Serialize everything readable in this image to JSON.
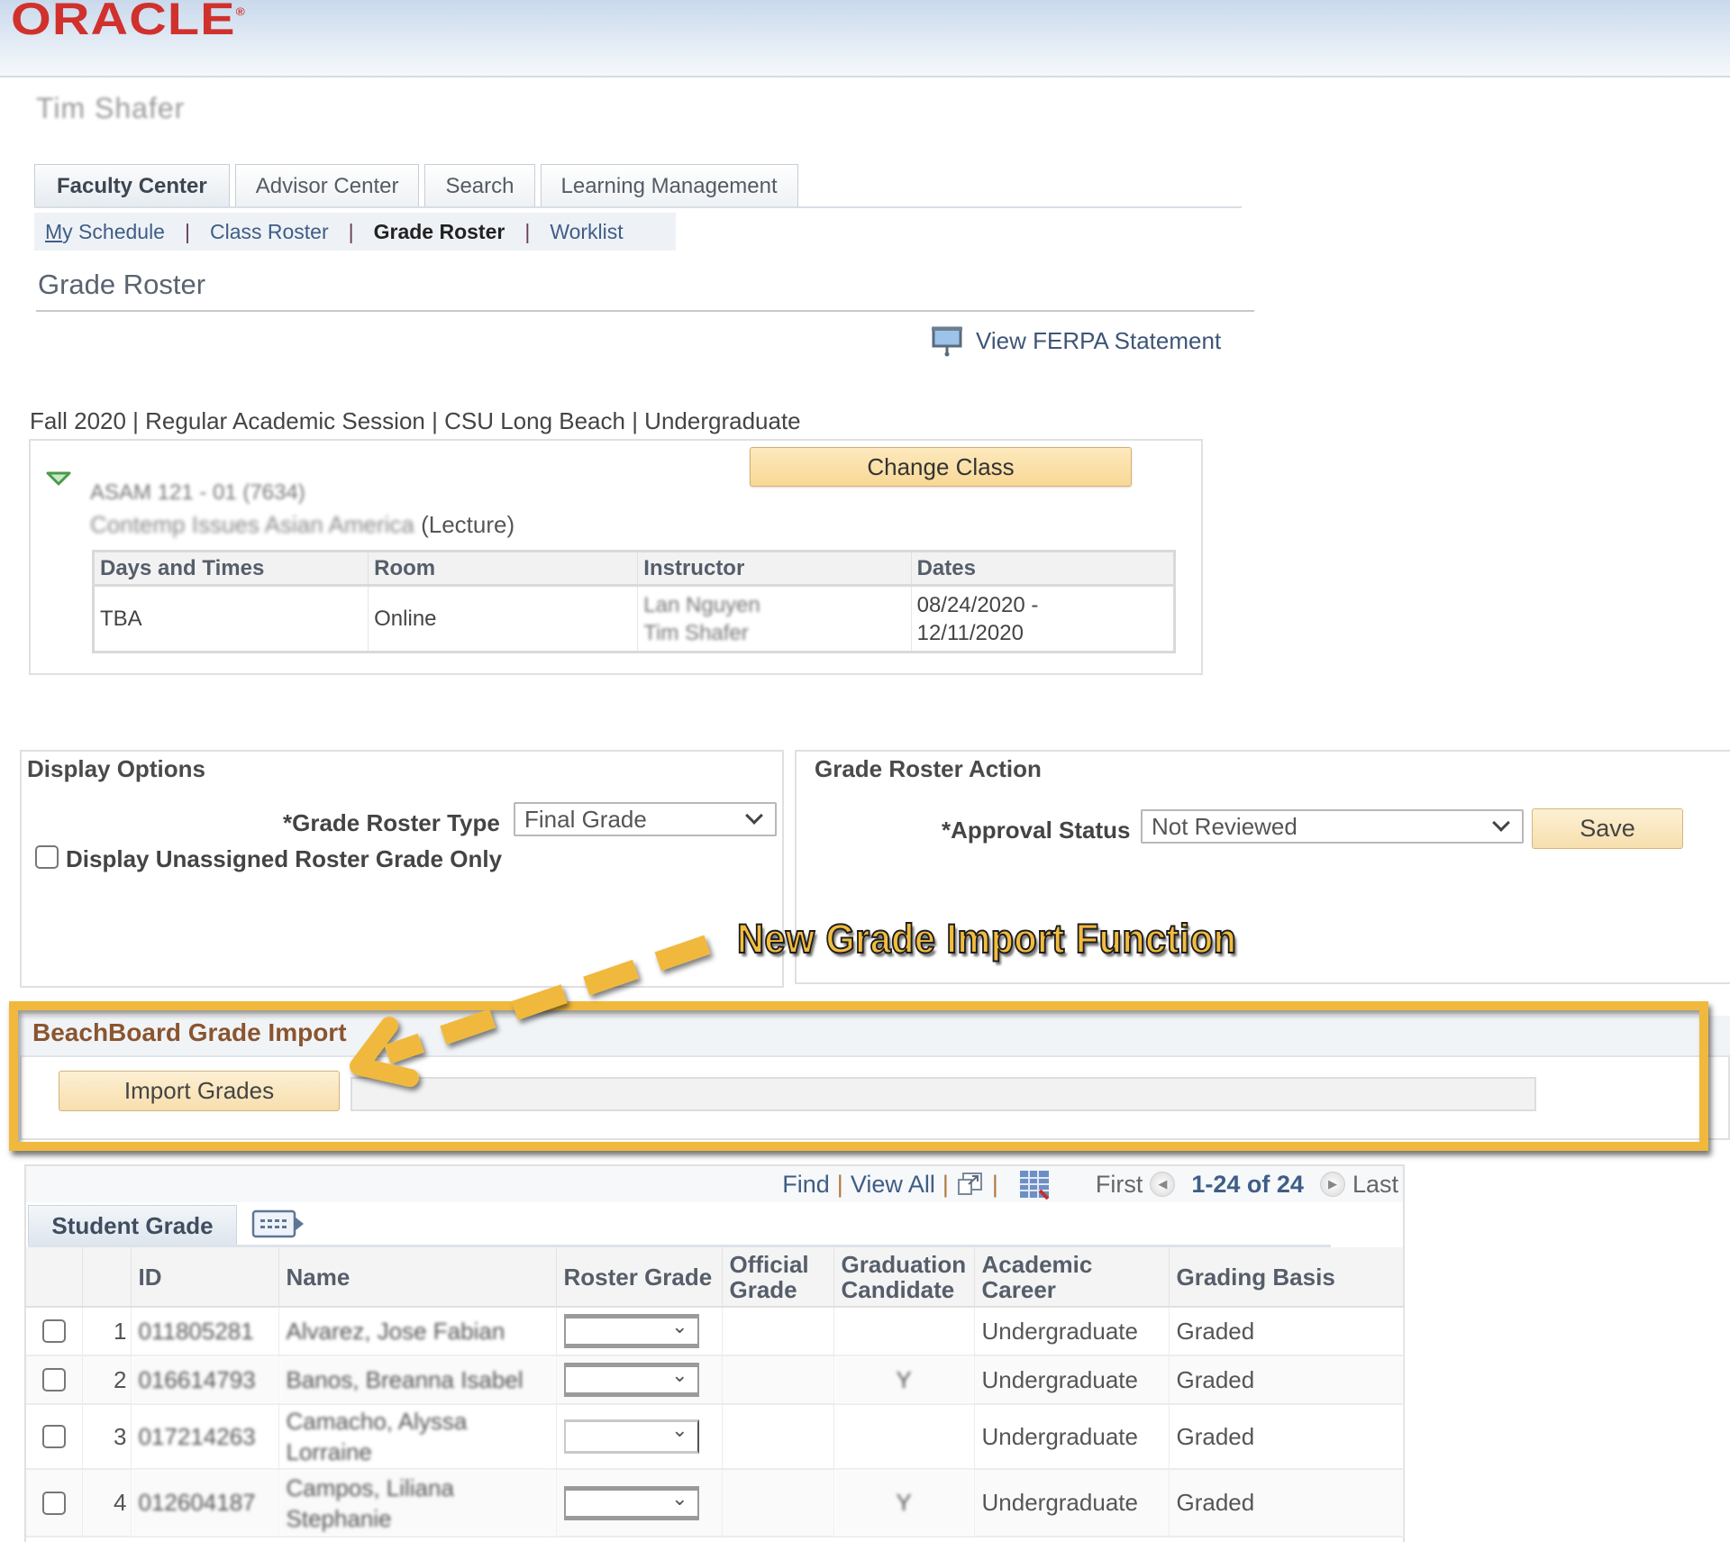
{
  "header": {
    "logo_text": "ORACLE",
    "logo_mark": "®",
    "user_name": "Tim Shafer"
  },
  "tabs": [
    {
      "label": "Faculty Center",
      "active": true
    },
    {
      "label": "Advisor Center",
      "active": false
    },
    {
      "label": "Search",
      "active": false
    },
    {
      "label": "Learning Management",
      "active": false
    }
  ],
  "subnav": {
    "my_schedule_prefix": "M",
    "my_schedule_rest": "y Schedule",
    "class_roster": "Class Roster",
    "grade_roster": "Grade Roster",
    "worklist": "Worklist",
    "separator": "|"
  },
  "page": {
    "title": "Grade Roster",
    "ferpa_link": "View FERPA Statement",
    "session_info": "Fall 2020 | Regular Academic Session | CSU Long Beach | Undergraduate"
  },
  "class_info": {
    "change_class_label": "Change Class",
    "class_code": "ASAM 121 - 01 (7634)",
    "class_title_blurred": "Contemp Issues Asian America",
    "class_type": "(Lecture)",
    "meeting_headers": [
      "Days and Times",
      "Room",
      "Instructor",
      "Dates"
    ],
    "meeting": {
      "days_times": "TBA",
      "room": "Online",
      "instructor_1": "Lan Nguyen",
      "instructor_2": "Tim Shafer",
      "dates_1": "08/24/2020 -",
      "dates_2": "12/11/2020"
    }
  },
  "display_options": {
    "title": "Display Options",
    "roster_type_label": "*Grade Roster Type",
    "roster_type_value": "Final Grade",
    "unassigned_label": "Display Unassigned Roster Grade Only",
    "unassigned_checked": false
  },
  "roster_action": {
    "title": "Grade Roster Action",
    "approval_label": "*Approval Status",
    "approval_value": "Not Reviewed",
    "save_label": "Save"
  },
  "annotation": {
    "text": "New Grade Import Function",
    "color": "#f0b93d"
  },
  "import": {
    "title": "BeachBoard Grade Import",
    "button_label": "Import Grades",
    "status_text": ""
  },
  "grid": {
    "find": "Find",
    "view_all": "View All",
    "sep": "|",
    "first": "First",
    "count": "1-24 of 24",
    "last": "Last",
    "tab_label": "Student Grade",
    "columns": [
      "",
      "",
      "ID",
      "Name",
      "Roster Grade",
      "Official Grade",
      "Graduation Candidate",
      "Academic Career",
      "Grading Basis"
    ],
    "rows": [
      {
        "num": "1",
        "id": "011805281",
        "name": "Alvarez, Jose Fabian",
        "roster_grade": "",
        "official_grade": "",
        "grad_candidate": "",
        "career": "Undergraduate",
        "basis": "Graded"
      },
      {
        "num": "2",
        "id": "016614793",
        "name": "Banos, Breanna Isabel",
        "roster_grade": "",
        "official_grade": "",
        "grad_candidate": "Y",
        "career": "Undergraduate",
        "basis": "Graded"
      },
      {
        "num": "3",
        "id": "017214263",
        "name": "Camacho, Alyssa Lorraine",
        "roster_grade": "",
        "official_grade": "",
        "grad_candidate": "",
        "career": "Undergraduate",
        "basis": "Graded"
      },
      {
        "num": "4",
        "id": "012604187",
        "name": "Campos, Liliana Stephanie",
        "roster_grade": "",
        "official_grade": "",
        "grad_candidate": "Y",
        "career": "Undergraduate",
        "basis": "Graded"
      }
    ]
  }
}
